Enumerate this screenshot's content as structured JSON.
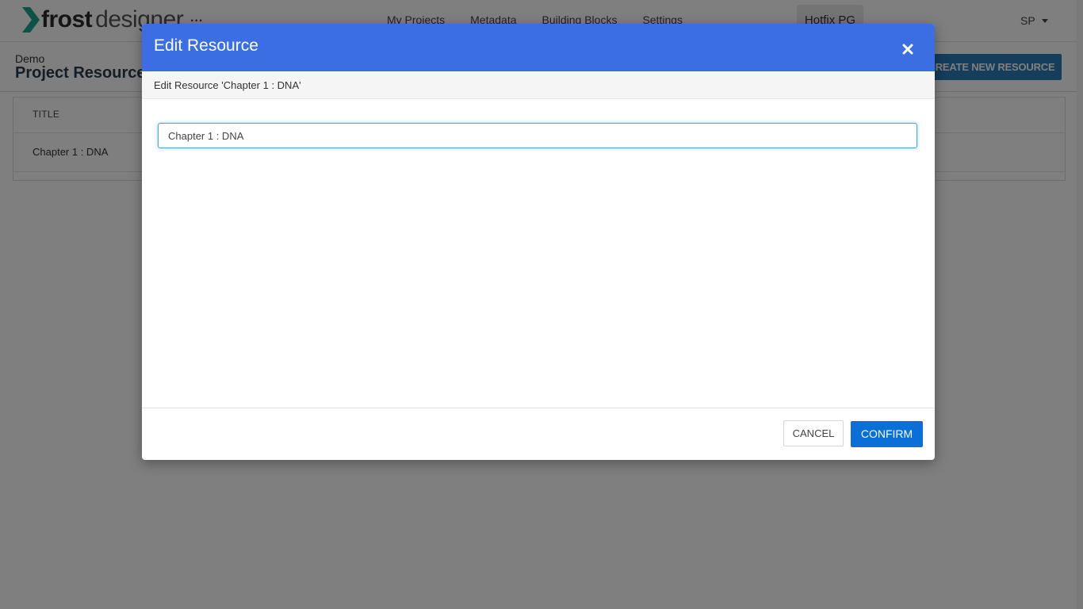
{
  "app": {
    "logo_bold": "frost",
    "logo_light": "designer",
    "more_menu": "...",
    "nav": [
      "My Projects",
      "Metadata",
      "Building Blocks",
      "Settings"
    ],
    "project_switcher": "Hotfix PG",
    "user_initials": "SP"
  },
  "page": {
    "breadcrumb": "Demo",
    "title": "Project Resources",
    "create_button": "CREATE NEW RESOURCE"
  },
  "table": {
    "columns": [
      "TITLE"
    ],
    "rows": [
      [
        "Chapter 1 : DNA"
      ]
    ]
  },
  "modal": {
    "title": "Edit Resource",
    "subtitle": "Edit Resource 'Chapter 1 : DNA'",
    "input_value": "Chapter 1 : DNA",
    "cancel_label": "CANCEL",
    "confirm_label": "CONFIRM"
  },
  "colors": {
    "modal_header": "#3b6ee3",
    "confirm_button": "#0a6fd6",
    "create_button": "#2a7ab8",
    "logo_chevron": "#1aa58a",
    "overlay": "rgba(0,0,0,0.5)"
  },
  "icons": {
    "logo_mark": "chevron-right-icon",
    "close": "close-icon",
    "user_dropdown": "caret-down-icon"
  }
}
